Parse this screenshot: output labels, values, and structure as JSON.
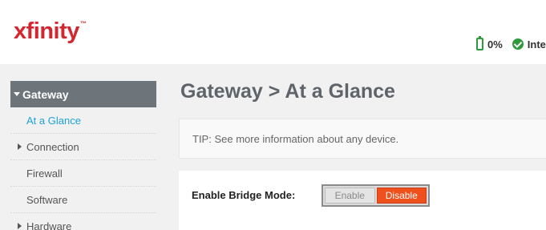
{
  "header": {
    "logo_text": "xfinity",
    "logo_tm": "™",
    "battery_percent": "0%",
    "internet_status": "Inte",
    "colors": {
      "brand": "#d3262e",
      "status_ok": "#2f9a3c"
    },
    "icons": {
      "battery": "battery-icon",
      "status": "check-circle-icon"
    }
  },
  "sidebar": {
    "section": "Gateway",
    "items": [
      {
        "label": "At a Glance",
        "active": true,
        "expandable": false
      },
      {
        "label": "Connection",
        "active": false,
        "expandable": true
      },
      {
        "label": "Firewall",
        "active": false,
        "expandable": false
      },
      {
        "label": "Software",
        "active": false,
        "expandable": false
      },
      {
        "label": "Hardware",
        "active": false,
        "expandable": true
      }
    ]
  },
  "main": {
    "title": "Gateway > At a Glance",
    "tip": "TIP: See more information about any device.",
    "bridge_mode": {
      "label": "Enable Bridge Mode:",
      "enable_label": "Enable",
      "disable_label": "Disable",
      "selected": "Disable",
      "accent_color": "#f0501c"
    }
  }
}
